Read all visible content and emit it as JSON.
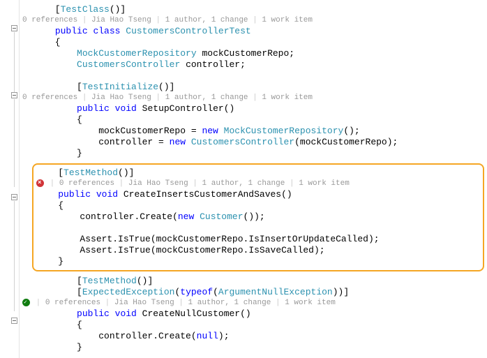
{
  "code": {
    "attr_testclass": "TestClass",
    "attr_testinitialize": "TestInitialize",
    "attr_testmethod": "TestMethod",
    "attr_expectedexception": "ExpectedException",
    "kw_public": "public",
    "kw_class": "class",
    "kw_void": "void",
    "kw_new": "new",
    "kw_typeof": "typeof",
    "kw_null": "null",
    "class_name": "CustomersControllerTest",
    "type_mockrepo": "MockCustomerRepository",
    "type_controller": "CustomersController",
    "type_customer": "Customer",
    "type_argnullex": "ArgumentNullException",
    "field_mockrepo": "mockCustomerRepo",
    "field_controller": "controller",
    "method_setup": "SetupController",
    "method_create_inserts": "CreateInsertsCustomerAndSaves",
    "method_create_null": "CreateNullCustomer",
    "call_create": "Create",
    "assert": "Assert",
    "assert_istrue": "IsTrue",
    "prop_isinsert": "IsInsertOrUpdateCalled",
    "prop_issave": "IsSaveCalled"
  },
  "codelens": {
    "refs": "0 references",
    "author": "Jia Hao Tseng",
    "changes": "1 author, 1 change",
    "work": "1 work item"
  },
  "chart_data": null
}
